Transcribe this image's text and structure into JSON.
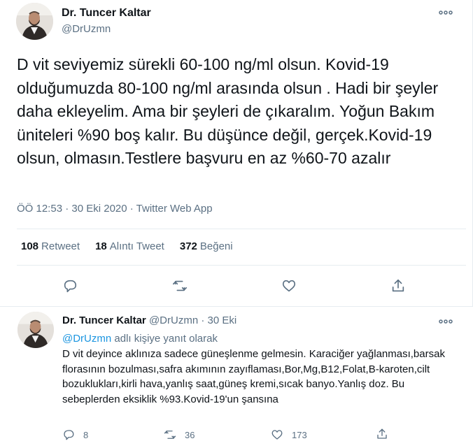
{
  "main_tweet": {
    "author_name": "Dr. Tuncer Kaltar",
    "author_handle": "@DrUzmn",
    "text": "D vit seviyemiz sürekli 60-100 ng/ml olsun. Kovid-19 olduğumuzda 80-100 ng/ml arasında olsun . Hadi bir şeyler daha ekleyelim. Ama bir şeyleri de çıkaralım. Yoğun Bakım üniteleri %90 boş kalır. Bu düşünce değil, gerçek.Kovid-19 olsun, olmasın.Testlere başvuru en az %60-70 azalır",
    "meta": "ÖÖ 12:53 · 30 Eki 2020 · Twitter Web App",
    "stats": [
      {
        "count": "108",
        "label": "Retweet"
      },
      {
        "count": "18",
        "label": "Alıntı Tweet"
      },
      {
        "count": "372",
        "label": "Beğeni"
      }
    ],
    "actions": [
      "reply-icon",
      "retweet-icon",
      "like-icon",
      "share-icon"
    ]
  },
  "reply_tweet": {
    "author_name": "Dr. Tuncer Kaltar",
    "meta": "@DrUzmn · 30 Eki",
    "reply_to_mention": "@DrUzmn",
    "reply_to_suffix": " adlı kişiye yanıt olarak",
    "text": "D vit deyince aklınıza sadece güneşlenme gelmesin. Karaciğer yağlanması,barsak florasının bozulması,safra akımının zayıflaması,Bor,Mg,B12,Folat,B-karoten,cilt bozuklukları,kirli hava,yanlış saat,güneş kremi,sıcak banyo.Yanlış doz. Bu sebeplerden eksiklik %93.Kovid-19'un şansına",
    "reply_count": "8",
    "retweet_count": "36",
    "like_count": "173"
  },
  "colors": {
    "text": "#0f1419",
    "secondary": "#5b7083",
    "link": "#1b95e0",
    "divider": "#e6ecf0"
  }
}
